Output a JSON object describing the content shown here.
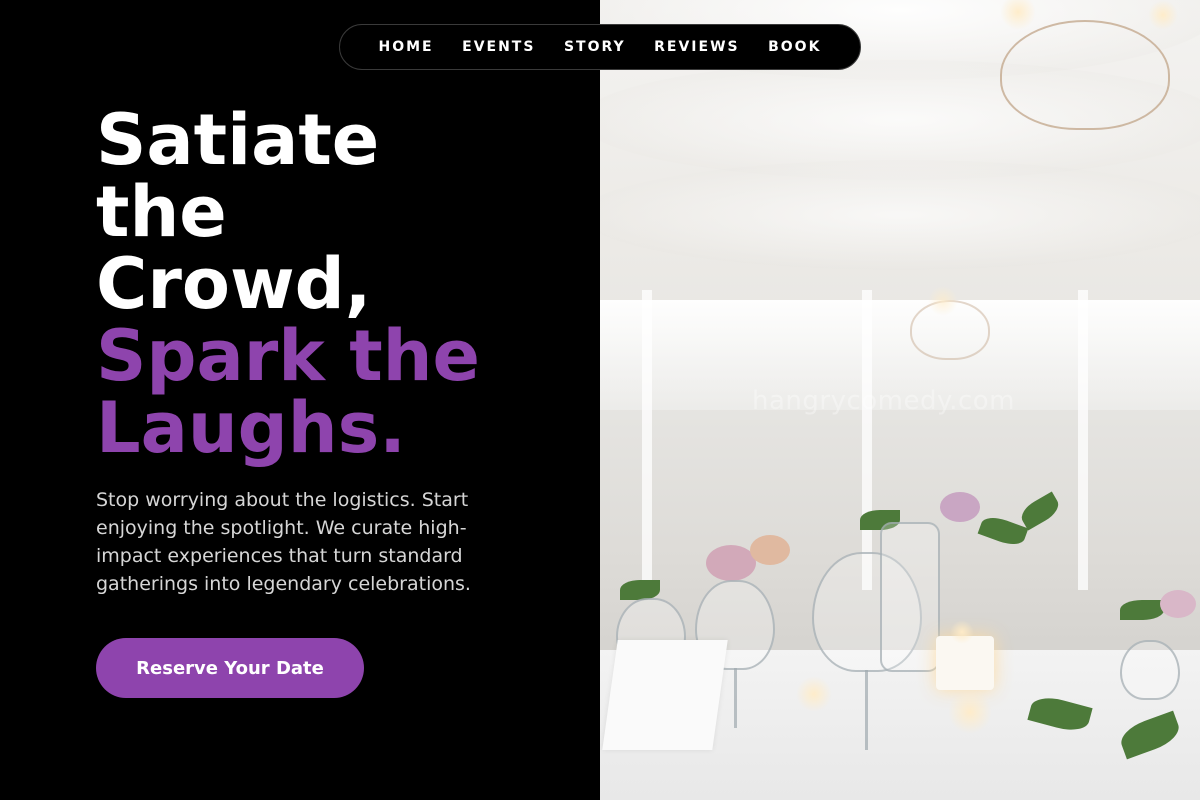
{
  "nav": {
    "items": [
      {
        "label": "HOME"
      },
      {
        "label": "EVENTS"
      },
      {
        "label": "STORY"
      },
      {
        "label": "REVIEWS"
      },
      {
        "label": "BOOK"
      }
    ]
  },
  "hero": {
    "headline_lines": [
      "Satiate",
      "the",
      "Crowd,"
    ],
    "accent_lines": [
      "Spark the",
      "Laughs."
    ],
    "description": "Stop worrying about the logistics. Start enjoying the spotlight. We curate high-impact experiences that turn standard gatherings into legendary celebrations.",
    "cta_label": "Reserve Your Date"
  },
  "photo": {
    "watermark": "hangrycomedy.com",
    "subject": "elegant event tent with table settings and chandeliers"
  },
  "colors": {
    "accent": "#8e44ad",
    "background": "#000000",
    "text": "#ffffff",
    "body_text": "#d6d6d6"
  }
}
